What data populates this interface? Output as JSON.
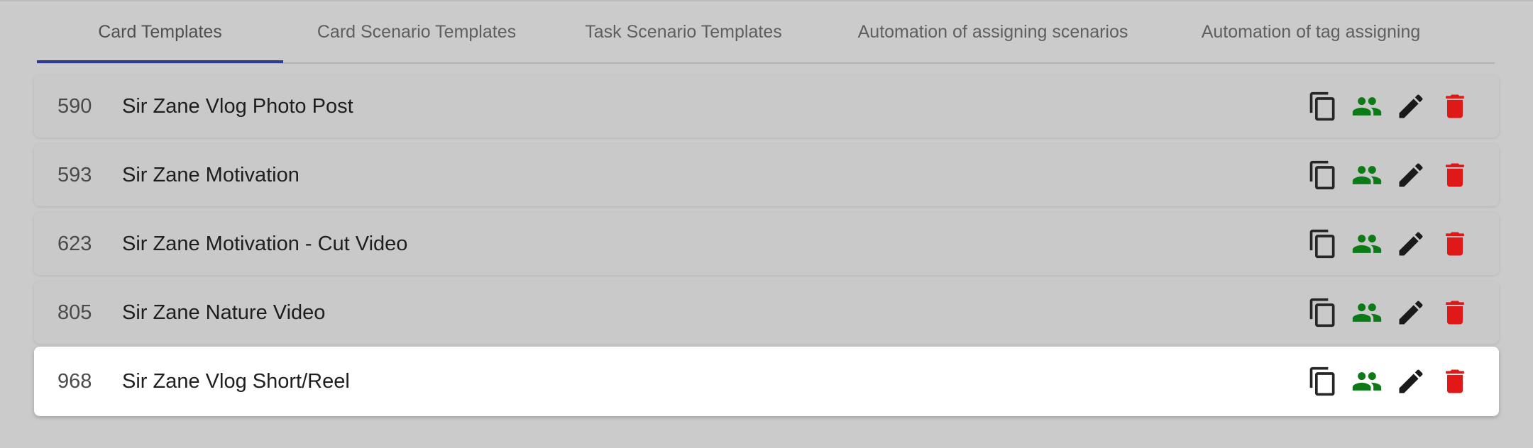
{
  "tabs": [
    {
      "label": "Card Templates",
      "active": true
    },
    {
      "label": "Card Scenario Templates",
      "active": false
    },
    {
      "label": "Task Scenario Templates",
      "active": false
    },
    {
      "label": "Automation of assigning scenarios",
      "active": false
    },
    {
      "label": "Automation of tag assigning",
      "active": false
    }
  ],
  "rows": [
    {
      "id": "590",
      "name": "Sir Zane Vlog Photo Post",
      "selected": false
    },
    {
      "id": "593",
      "name": "Sir Zane Motivation",
      "selected": false
    },
    {
      "id": "623",
      "name": "Sir Zane Motivation - Cut Video",
      "selected": false
    },
    {
      "id": "805",
      "name": "Sir Zane Nature Video",
      "selected": false
    },
    {
      "id": "968",
      "name": "Sir Zane Vlog Short/Reel",
      "selected": true
    }
  ],
  "row_actions": [
    {
      "icon": "copy-icon"
    },
    {
      "icon": "group-icon"
    },
    {
      "icon": "edit-icon"
    },
    {
      "icon": "delete-icon"
    }
  ],
  "colors": {
    "tab_indicator": "#2f3c8e",
    "group_icon": "#0c7a17",
    "delete_icon": "#e01818",
    "edit_icon": "#1a1a1a",
    "copy_icon": "#262626"
  }
}
